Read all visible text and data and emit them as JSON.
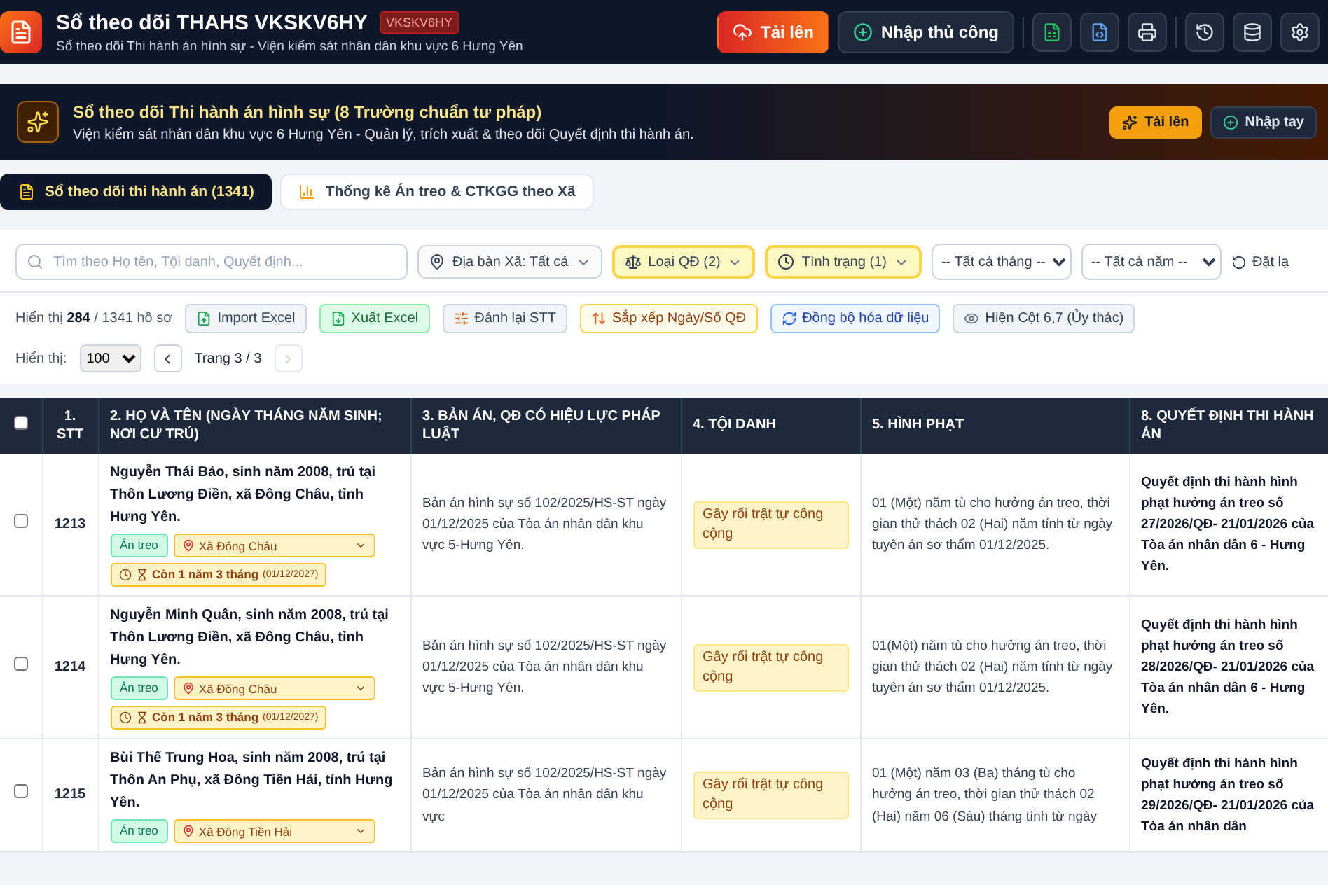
{
  "header": {
    "title": "Sổ theo dõi THAHS VKSKV6HY",
    "code_badge": "VKSKV6HY",
    "subtitle": "Sổ theo dõi Thi hành án hình sự - Viện kiểm sát nhân dân khu vực 6 Hưng Yên",
    "actions": [
      {
        "kind": "primary",
        "label": "Tải lên"
      },
      {
        "kind": "outline",
        "label": "Nhập thủ công"
      }
    ]
  },
  "banner": {
    "title": "Sổ theo dõi Thi hành án hình sự (8 Trường chuẩn tư pháp)",
    "subtitle": "Viện kiểm sát nhân dân khu vực 6 Hưng Yên - Quản lý, trích xuất & theo dõi Quyết định thi hành án.",
    "buttons": [
      {
        "kind": "primary",
        "label": "Tải lên"
      },
      {
        "kind": "outline",
        "label": "Nhập tay"
      }
    ]
  },
  "tabs": [
    {
      "kind": "book",
      "label": "Sổ theo dõi thi hành án (1341)",
      "selected": true
    },
    {
      "kind": "chart",
      "label": "Thống kê Án treo & CTKGG theo Xã",
      "selected": false
    }
  ],
  "filters": {
    "search": {
      "placeholder": "Tìm theo Họ tên, Tội danh, Quyết định..."
    },
    "dropdowns": [
      {
        "kind": "place",
        "label": "Địa bàn Xã: Tất cả",
        "active": false
      },
      {
        "kind": "scale",
        "label": "Loại QĐ (2)",
        "active": true
      },
      {
        "kind": "clock",
        "label": "Tình trạng (1)",
        "active": true
      }
    ],
    "selects": [
      {
        "value": "-- Tất cả tháng --"
      },
      {
        "value": "-- Tất cả năm --"
      }
    ],
    "reset": "Đặt lạ"
  },
  "summary": "Hiển thị **284** / 1341 hồ sơ",
  "tools": [
    {
      "kind": "import",
      "label": "Import Excel"
    },
    {
      "kind": "export",
      "label": "Xuất Excel"
    },
    {
      "kind": "renumber",
      "label": "Đánh lại STT"
    },
    {
      "kind": "sort",
      "label": "Sắp xếp Ngày/Số QĐ"
    },
    {
      "kind": "sync",
      "label": "Đồng bộ hóa dữ liệu"
    },
    {
      "kind": "columns",
      "label": "Hiện Cột 6,7 (Ủy thác)"
    }
  ],
  "paging": {
    "label": "Hiển thị:",
    "page_size": "100",
    "page": "Trang 3 / 3",
    "prev_disabled": false,
    "next_disabled": true
  },
  "table": {
    "all_checked": false,
    "columns": [
      "1. STT",
      "2. HỌ VÀ TÊN (NGÀY THÁNG NĂM SINH; NƠI CƯ TRÚ)",
      "3. BẢN ÁN, QĐ CÓ HIỆU LỰC PHÁP LUẬT",
      "4. TỘI DANH",
      "5. HÌNH PHẠT",
      "8. QUYẾT ĐỊNH THI HÀNH ÁN"
    ],
    "rows": [
      {
        "checked": false,
        "stt": "1213",
        "name": "Nguyễn Thái Bảo, sinh năm 2008, trú tại Thôn Lương Điền, xã Đông Châu, tỉnh Hưng Yên.",
        "status": "Án treo",
        "commune": "Xã Đông Châu",
        "remaining": "Còn 1 năm 3 tháng",
        "remaining_date": "(01/12/2027)",
        "judgment": "Bản án hình sự số 102/2025/HS-ST ngày 01/12/2025 của Tòa án nhân dân khu vực 5-Hưng Yên.",
        "crime": "Gây rối trật tự công cộng",
        "penalty": "01 (Một) năm tù cho hưởng án treo, thời gian thử thách 02 (Hai) năm tính từ ngày tuyên án sơ thẩm 01/12/2025.",
        "decision": "Quyết định thi hành hình phạt hưởng án treo số 27/2026/QĐ- 21/01/2026 của Tòa án nhân dân 6 - Hưng Yên."
      },
      {
        "checked": false,
        "stt": "1214",
        "name": "Nguyễn Minh Quân, sinh năm 2008, trú tại Thôn Lương Điền, xã Đông Châu, tỉnh Hưng Yên.",
        "status": "Án treo",
        "commune": "Xã Đông Châu",
        "remaining": "Còn 1 năm 3 tháng",
        "remaining_date": "(01/12/2027)",
        "judgment": "Bản án hình sự số 102/2025/HS-ST ngày 01/12/2025 của Tòa án nhân dân khu vực 5-Hưng Yên.",
        "crime": "Gây rối trật tự công cộng",
        "penalty": "01(Một) năm tù cho hưởng án treo, thời gian thử thách 02 (Hai) năm tính từ ngày tuyên án sơ thẩm 01/12/2025.",
        "decision": "Quyết định thi hành hình phạt hưởng án treo số 28/2026/QĐ- 21/01/2026 của Tòa án nhân dân 6 - Hưng Yên."
      },
      {
        "checked": false,
        "stt": "1215",
        "name": "Bùi Thế Trung Hoa, sinh năm 2008, trú tại Thôn An Phụ, xã Đông Tiền Hải, tỉnh Hưng Yên.",
        "status": "Án treo",
        "commune": "Xã Đông Tiền Hải",
        "judgment": "Bản án hình sự số 102/2025/HS-ST ngày 01/12/2025 của Tòa án nhân dân khu vực",
        "crime": "Gây rối trật tự công cộng",
        "penalty": "01 (Một) năm 03 (Ba) tháng tù cho hưởng án treo, thời gian thử thách 02 (Hai) năm 06 (Sáu) tháng tính từ ngày",
        "decision": "Quyết định thi hành hình phạt hưởng án treo số 29/2026/QĐ- 21/01/2026 của Tòa án nhân dân"
      }
    ]
  }
}
